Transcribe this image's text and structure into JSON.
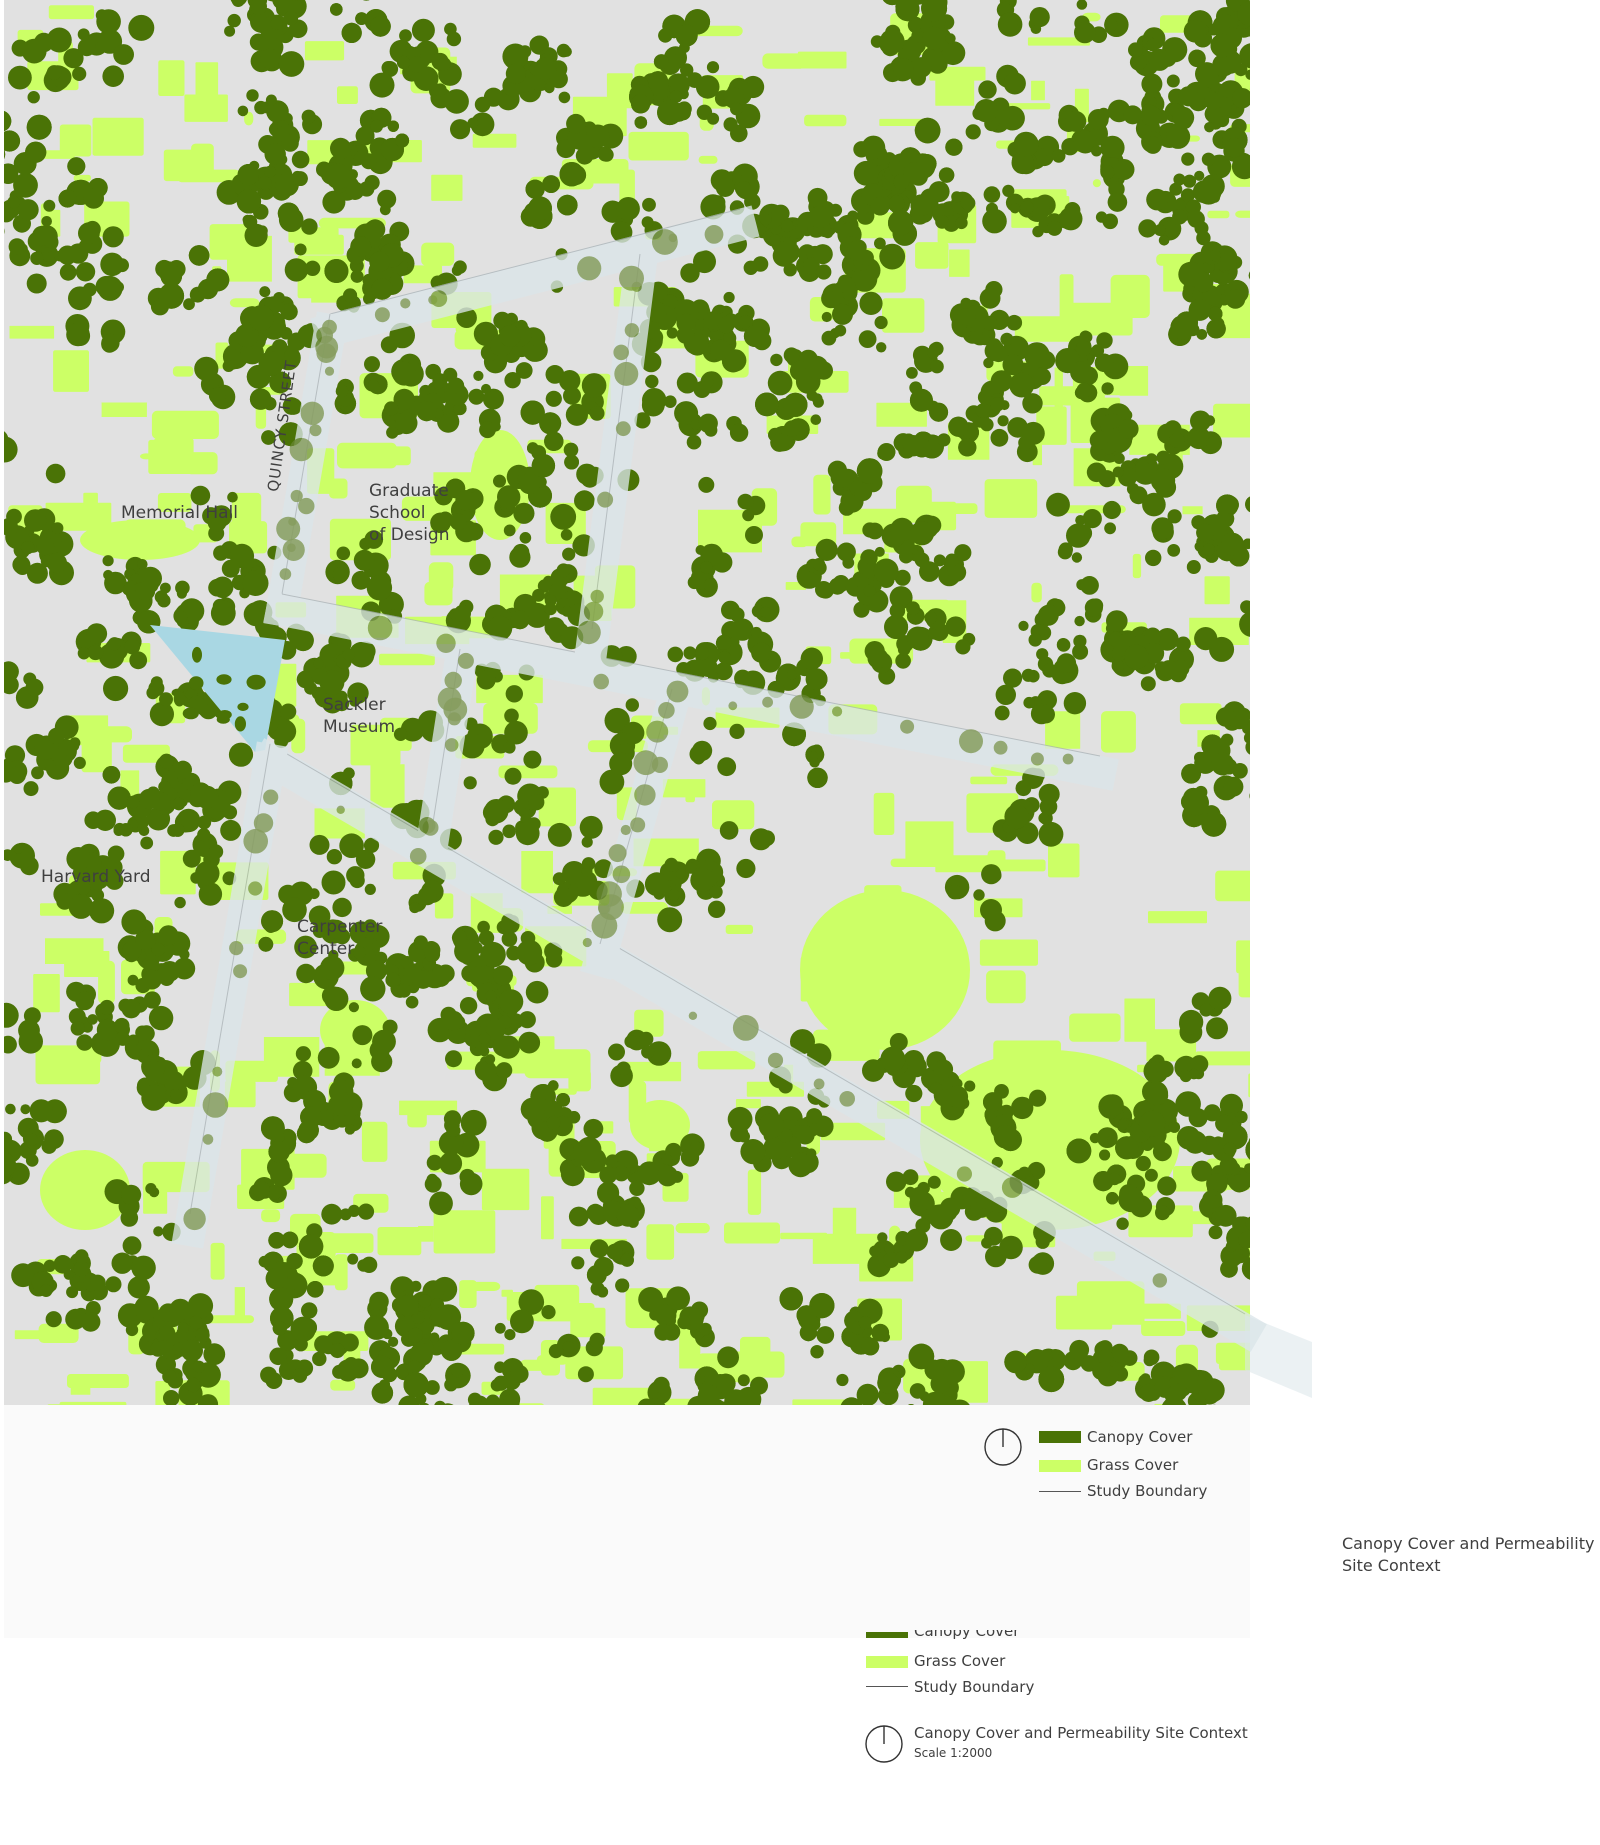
{
  "colors": {
    "canopy": "#4a7306",
    "grass": "#ccff66",
    "ground": "#e1e1e1",
    "boundary": "#dbe6ea",
    "water": "#a9d7e3"
  },
  "map": {
    "places": {
      "memorial_hall": "Memorial Hall",
      "quincy_street": "QUINCY STREET",
      "gsd": "Graduate\nSchool\nof Design",
      "sackler": "Sackler\nMuseum",
      "harvard_yard": "Harvard Yard",
      "carpenter": "Carpenter\nCenter"
    }
  },
  "legend": {
    "canopy": "Canopy Cover",
    "grass": "Grass Cover",
    "boundary": "Study Boundary",
    "north_icon": "north-arrow-icon"
  },
  "side_title": {
    "line1": "Canopy Cover and Permeability",
    "line2": "Site Context"
  },
  "legend2": {
    "canopy": "Canopy Cover",
    "grass": "Grass Cover",
    "boundary": "Study Boundary",
    "title": "Canopy Cover and Permeability Site Context",
    "scale": "Scale 1:2000"
  }
}
